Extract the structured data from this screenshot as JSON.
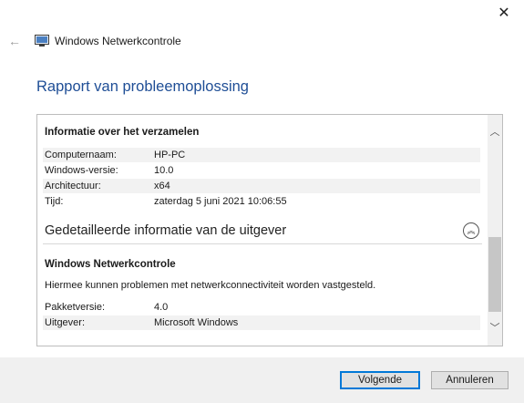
{
  "window": {
    "title": "Windows Netwerkcontrole",
    "close_glyph": "✕",
    "back_glyph": "←"
  },
  "page": {
    "heading": "Rapport van probleemoplossing"
  },
  "collection": {
    "title": "Informatie over het verzamelen",
    "rows": [
      {
        "label": "Computernaam:",
        "value": "HP-PC"
      },
      {
        "label": "Windows-versie:",
        "value": "10.0"
      },
      {
        "label": "Architectuur:",
        "value": "x64"
      },
      {
        "label": "Tijd:",
        "value": "zaterdag 5 juni 2021 10:06:55"
      }
    ]
  },
  "publisher": {
    "heading": "Gedetailleerde informatie van de uitgever",
    "collapse_glyph": "︽",
    "name": "Windows Netwerkcontrole",
    "description": "Hiermee kunnen problemen met netwerkconnectiviteit worden vastgesteld.",
    "rows": [
      {
        "label": "Pakketversie:",
        "value": "4.0"
      },
      {
        "label": "Uitgever:",
        "value": "Microsoft Windows"
      }
    ]
  },
  "scrollbar": {
    "up_glyph": "︿",
    "down_glyph": "﹀"
  },
  "buttons": {
    "next": "Volgende",
    "cancel": "Annuleren"
  },
  "colors": {
    "heading": "#1f4e96",
    "accent": "#0078d7"
  }
}
